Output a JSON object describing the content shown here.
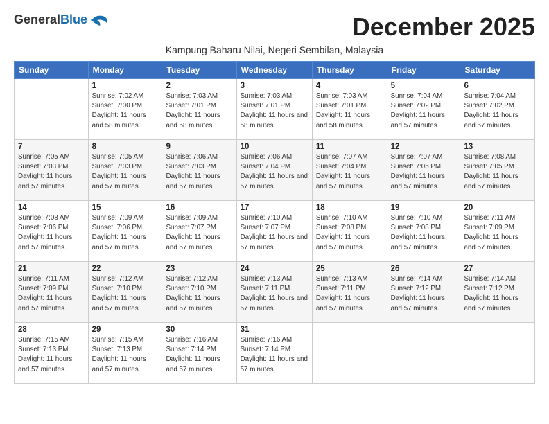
{
  "logo": {
    "general": "General",
    "blue": "Blue"
  },
  "title": "December 2025",
  "subtitle": "Kampung Baharu Nilai, Negeri Sembilan, Malaysia",
  "days_of_week": [
    "Sunday",
    "Monday",
    "Tuesday",
    "Wednesday",
    "Thursday",
    "Friday",
    "Saturday"
  ],
  "weeks": [
    [
      {
        "day": "",
        "info": ""
      },
      {
        "day": "1",
        "info": "Sunrise: 7:02 AM\nSunset: 7:00 PM\nDaylight: 11 hours\nand 58 minutes."
      },
      {
        "day": "2",
        "info": "Sunrise: 7:03 AM\nSunset: 7:01 PM\nDaylight: 11 hours\nand 58 minutes."
      },
      {
        "day": "3",
        "info": "Sunrise: 7:03 AM\nSunset: 7:01 PM\nDaylight: 11 hours\nand 58 minutes."
      },
      {
        "day": "4",
        "info": "Sunrise: 7:03 AM\nSunset: 7:01 PM\nDaylight: 11 hours\nand 58 minutes."
      },
      {
        "day": "5",
        "info": "Sunrise: 7:04 AM\nSunset: 7:02 PM\nDaylight: 11 hours\nand 57 minutes."
      },
      {
        "day": "6",
        "info": "Sunrise: 7:04 AM\nSunset: 7:02 PM\nDaylight: 11 hours\nand 57 minutes."
      }
    ],
    [
      {
        "day": "7",
        "info": "Sunrise: 7:05 AM\nSunset: 7:03 PM\nDaylight: 11 hours\nand 57 minutes."
      },
      {
        "day": "8",
        "info": "Sunrise: 7:05 AM\nSunset: 7:03 PM\nDaylight: 11 hours\nand 57 minutes."
      },
      {
        "day": "9",
        "info": "Sunrise: 7:06 AM\nSunset: 7:03 PM\nDaylight: 11 hours\nand 57 minutes."
      },
      {
        "day": "10",
        "info": "Sunrise: 7:06 AM\nSunset: 7:04 PM\nDaylight: 11 hours\nand 57 minutes."
      },
      {
        "day": "11",
        "info": "Sunrise: 7:07 AM\nSunset: 7:04 PM\nDaylight: 11 hours\nand 57 minutes."
      },
      {
        "day": "12",
        "info": "Sunrise: 7:07 AM\nSunset: 7:05 PM\nDaylight: 11 hours\nand 57 minutes."
      },
      {
        "day": "13",
        "info": "Sunrise: 7:08 AM\nSunset: 7:05 PM\nDaylight: 11 hours\nand 57 minutes."
      }
    ],
    [
      {
        "day": "14",
        "info": "Sunrise: 7:08 AM\nSunset: 7:06 PM\nDaylight: 11 hours\nand 57 minutes."
      },
      {
        "day": "15",
        "info": "Sunrise: 7:09 AM\nSunset: 7:06 PM\nDaylight: 11 hours\nand 57 minutes."
      },
      {
        "day": "16",
        "info": "Sunrise: 7:09 AM\nSunset: 7:07 PM\nDaylight: 11 hours\nand 57 minutes."
      },
      {
        "day": "17",
        "info": "Sunrise: 7:10 AM\nSunset: 7:07 PM\nDaylight: 11 hours\nand 57 minutes."
      },
      {
        "day": "18",
        "info": "Sunrise: 7:10 AM\nSunset: 7:08 PM\nDaylight: 11 hours\nand 57 minutes."
      },
      {
        "day": "19",
        "info": "Sunrise: 7:10 AM\nSunset: 7:08 PM\nDaylight: 11 hours\nand 57 minutes."
      },
      {
        "day": "20",
        "info": "Sunrise: 7:11 AM\nSunset: 7:09 PM\nDaylight: 11 hours\nand 57 minutes."
      }
    ],
    [
      {
        "day": "21",
        "info": "Sunrise: 7:11 AM\nSunset: 7:09 PM\nDaylight: 11 hours\nand 57 minutes."
      },
      {
        "day": "22",
        "info": "Sunrise: 7:12 AM\nSunset: 7:10 PM\nDaylight: 11 hours\nand 57 minutes."
      },
      {
        "day": "23",
        "info": "Sunrise: 7:12 AM\nSunset: 7:10 PM\nDaylight: 11 hours\nand 57 minutes."
      },
      {
        "day": "24",
        "info": "Sunrise: 7:13 AM\nSunset: 7:11 PM\nDaylight: 11 hours\nand 57 minutes."
      },
      {
        "day": "25",
        "info": "Sunrise: 7:13 AM\nSunset: 7:11 PM\nDaylight: 11 hours\nand 57 minutes."
      },
      {
        "day": "26",
        "info": "Sunrise: 7:14 AM\nSunset: 7:12 PM\nDaylight: 11 hours\nand 57 minutes."
      },
      {
        "day": "27",
        "info": "Sunrise: 7:14 AM\nSunset: 7:12 PM\nDaylight: 11 hours\nand 57 minutes."
      }
    ],
    [
      {
        "day": "28",
        "info": "Sunrise: 7:15 AM\nSunset: 7:13 PM\nDaylight: 11 hours\nand 57 minutes."
      },
      {
        "day": "29",
        "info": "Sunrise: 7:15 AM\nSunset: 7:13 PM\nDaylight: 11 hours\nand 57 minutes."
      },
      {
        "day": "30",
        "info": "Sunrise: 7:16 AM\nSunset: 7:14 PM\nDaylight: 11 hours\nand 57 minutes."
      },
      {
        "day": "31",
        "info": "Sunrise: 7:16 AM\nSunset: 7:14 PM\nDaylight: 11 hours\nand 57 minutes."
      },
      {
        "day": "",
        "info": ""
      },
      {
        "day": "",
        "info": ""
      },
      {
        "day": "",
        "info": ""
      }
    ]
  ]
}
